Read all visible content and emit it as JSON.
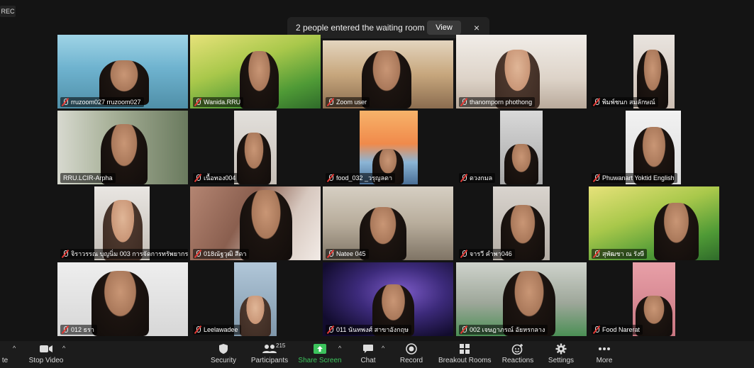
{
  "recording_badge": "REC",
  "waiting_notice": {
    "message": "2 people entered the waiting room",
    "view_label": "View",
    "close_label": "×"
  },
  "participants": [
    {
      "name": "rruzoom027 rruzoom027",
      "muted": true
    },
    {
      "name": "Wanida.RRU",
      "muted": true
    },
    {
      "name": "Zoom user",
      "muted": true
    },
    {
      "name": "thanomporn phothong",
      "muted": true
    },
    {
      "name": "พิมพ์ชนก สมลักษณ์",
      "muted": true
    },
    {
      "name": "RRU.LCIR-Arpha",
      "muted": false,
      "active_speaker": true
    },
    {
      "name": "เนื้อทอง004",
      "muted": true
    },
    {
      "name": "food_032 _วรุญลดา",
      "muted": true
    },
    {
      "name": "ดวงกมล",
      "muted": true
    },
    {
      "name": "Phuwanart Yoktid English",
      "muted": true
    },
    {
      "name": "จิราวรรณ บุญนิ่ม 003 การจัดการทรัพยากร...",
      "muted": true
    },
    {
      "name": "018ณัฐวุฒิ สีดา",
      "muted": true
    },
    {
      "name": "Natee 045",
      "muted": true
    },
    {
      "name": "จารวี คำพา046",
      "muted": true
    },
    {
      "name": "สุพัฒชา ณ รังษี",
      "muted": true
    },
    {
      "name": "012 ธรา",
      "muted": true
    },
    {
      "name": "Leelawadee",
      "muted": true
    },
    {
      "name": "011 นันทพงศ์ สาขาอังกฤษ",
      "muted": true
    },
    {
      "name": "002 เจษฎาภรณ์ อัยหรกลาง",
      "muted": true
    },
    {
      "name": "Food Narerat",
      "muted": true
    }
  ],
  "toolbar": {
    "left_partial_label": "te",
    "stop_video": "Stop Video",
    "security": "Security",
    "participants": "Participants",
    "participants_count": "215",
    "share_screen": "Share Screen",
    "chat": "Chat",
    "record": "Record",
    "breakout_rooms": "Breakout Rooms",
    "reactions": "Reactions",
    "settings": "Settings",
    "more": "More",
    "caret": "^"
  },
  "colors": {
    "active_speaker_border": "#c9d96b",
    "share_screen_green": "#3cc35c",
    "muted_red": "#e53935"
  }
}
